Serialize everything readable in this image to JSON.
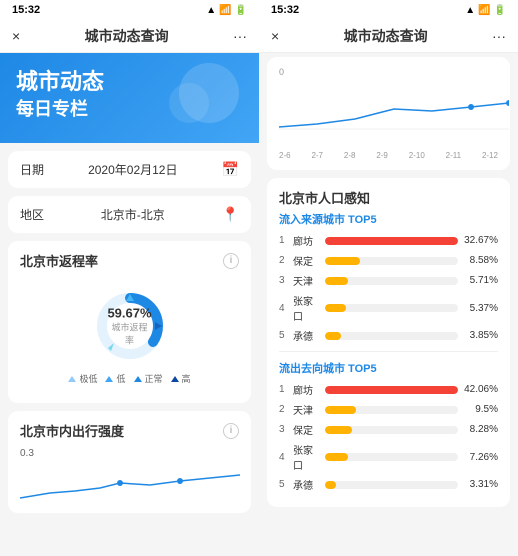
{
  "left": {
    "statusBar": {
      "time": "15:32"
    },
    "navBar": {
      "title": "城市动态查询",
      "close": "×",
      "menu": "···"
    },
    "hero": {
      "line1": "城市动态",
      "line2": "每日专栏"
    },
    "dateField": {
      "label": "日期",
      "value": "2020年02月12日"
    },
    "regionField": {
      "label": "地区",
      "value": "北京市-北京"
    },
    "returnRate": {
      "title": "北京市返程率",
      "percent": "59.67%",
      "sublabel": "城市返程率",
      "legend": [
        {
          "label": "极低",
          "color": "#90caf9"
        },
        {
          "label": "低",
          "color": "#42a5f5"
        },
        {
          "label": "正常",
          "color": "#1e88e5"
        },
        {
          "label": "高",
          "color": "#0d47a1"
        }
      ]
    },
    "activityCard": {
      "title": "北京市内出行强度",
      "value": "0.3"
    }
  },
  "right": {
    "statusBar": {
      "time": "15:32"
    },
    "navBar": {
      "title": "城市动态查询",
      "close": "×",
      "menu": "···"
    },
    "chartLabels": [
      "2-6",
      "2-7",
      "2-8",
      "2-9",
      "2-10",
      "2-11",
      "2-12"
    ],
    "chartYLabel": "0",
    "population": {
      "title": "北京市人口感知",
      "inflow": {
        "label": "流入来源城市 TOP5",
        "items": [
          {
            "rank": "1",
            "name": "廊坊",
            "pct": 32.67,
            "pctLabel": "32.67%",
            "color": "#f44336"
          },
          {
            "rank": "2",
            "name": "保定",
            "pct": 8.58,
            "pctLabel": "8.58%",
            "color": "#ffb300"
          },
          {
            "rank": "3",
            "name": "天津",
            "pct": 5.71,
            "pctLabel": "5.71%",
            "color": "#ffb300"
          },
          {
            "rank": "4",
            "name": "张家口",
            "pct": 5.37,
            "pctLabel": "5.37%",
            "color": "#ffb300"
          },
          {
            "rank": "5",
            "name": "承德",
            "pct": 3.85,
            "pctLabel": "3.85%",
            "color": "#ffb300"
          }
        ]
      },
      "outflow": {
        "label": "流出去向城市 TOP5",
        "items": [
          {
            "rank": "1",
            "name": "廊坊",
            "pct": 42.06,
            "pctLabel": "42.06%",
            "color": "#f44336"
          },
          {
            "rank": "2",
            "name": "天津",
            "pct": 9.5,
            "pctLabel": "9.5%",
            "color": "#ffb300"
          },
          {
            "rank": "3",
            "name": "保定",
            "pct": 8.28,
            "pctLabel": "8.28%",
            "color": "#ffb300"
          },
          {
            "rank": "4",
            "name": "张家口",
            "pct": 7.26,
            "pctLabel": "7.26%",
            "color": "#ffb300"
          },
          {
            "rank": "5",
            "name": "承德",
            "pct": 3.31,
            "pctLabel": "3.31%",
            "color": "#ffb300"
          }
        ]
      }
    }
  },
  "colors": {
    "accent": "#1e88e5",
    "red": "#f44336",
    "orange": "#ffb300",
    "donut": "#1e88e5"
  }
}
